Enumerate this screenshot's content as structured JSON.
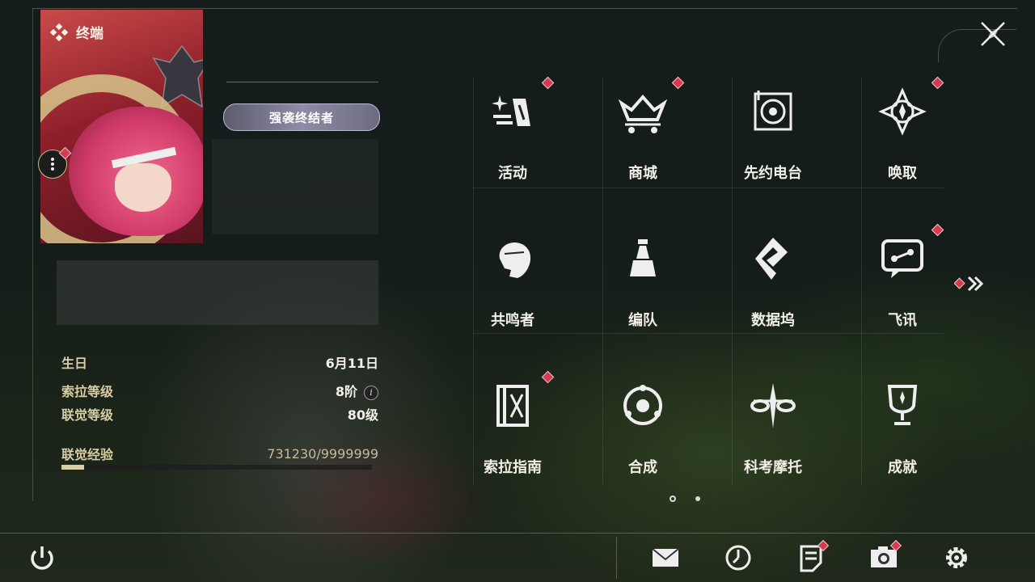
{
  "header": {
    "title": "终端",
    "title_icon": "diamond-cluster-icon",
    "close_icon": "close-x-icon"
  },
  "profile": {
    "title_badge": "强袭终结者",
    "stats": [
      {
        "key": "生日",
        "value": "6月11日"
      },
      {
        "key": "索拉等级",
        "value": "8阶",
        "info": "i"
      },
      {
        "key": "联觉等级",
        "value": "80级"
      },
      {
        "key": "联觉经验",
        "value": "731230/9999999"
      }
    ],
    "xp_fraction": 0.0731
  },
  "menu": [
    {
      "label": "活动",
      "icon": "activity-icon",
      "badge": true
    },
    {
      "label": "商城",
      "icon": "shop-icon",
      "badge": true
    },
    {
      "label": "先约电台",
      "icon": "radio-icon",
      "badge": false
    },
    {
      "label": "唤取",
      "icon": "convene-icon",
      "badge": true
    },
    {
      "label": "共鸣者",
      "icon": "resonator-icon",
      "badge": false
    },
    {
      "label": "编队",
      "icon": "team-icon",
      "badge": false
    },
    {
      "label": "数据坞",
      "icon": "databank-icon",
      "badge": false
    },
    {
      "label": "飞讯",
      "icon": "message-icon",
      "badge": true
    },
    {
      "label": "索拉指南",
      "icon": "guidebook-icon",
      "badge": true
    },
    {
      "label": "合成",
      "icon": "synthesis-icon",
      "badge": false
    },
    {
      "label": "科考摩托",
      "icon": "motorbike-icon",
      "badge": false
    },
    {
      "label": "成就",
      "icon": "trophy-icon",
      "badge": false
    }
  ],
  "pagination": {
    "current": 1,
    "total": 2
  },
  "colors": {
    "accent": "#d8cda5",
    "badge": "#d9394e",
    "text": "#f2efe6"
  },
  "bottom_bar": {
    "left": "power-icon",
    "right": [
      {
        "icon": "mail-icon",
        "badge": false
      },
      {
        "icon": "clock-icon",
        "badge": false
      },
      {
        "icon": "notes-icon",
        "badge": true
      },
      {
        "icon": "camera-icon",
        "badge": true
      },
      {
        "icon": "settings-gear-icon",
        "badge": false
      }
    ]
  }
}
